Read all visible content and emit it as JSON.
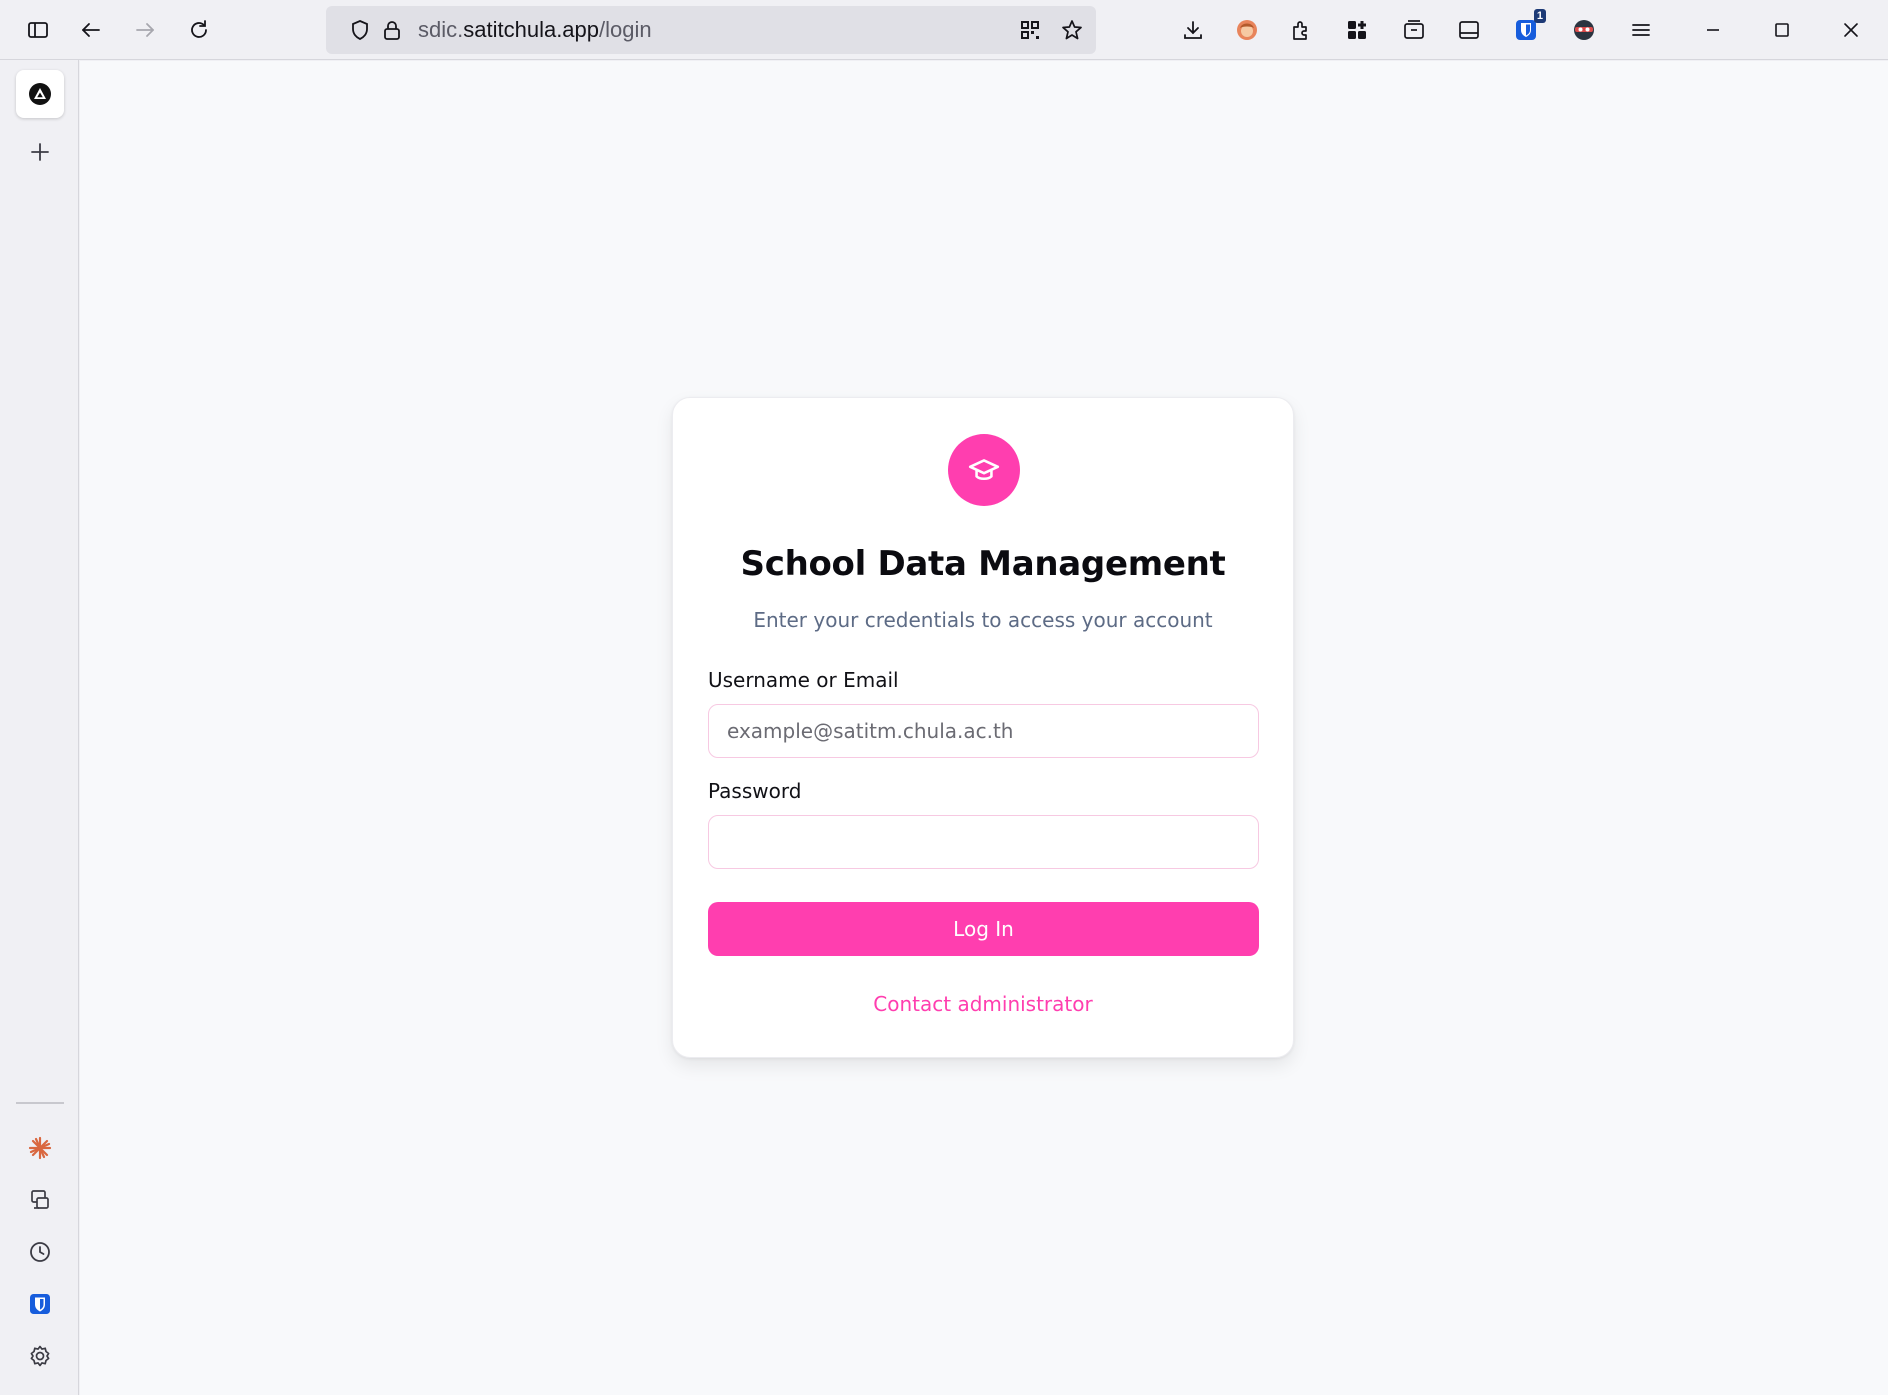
{
  "browser": {
    "url_prefix": "sdic.",
    "url_host": "satitchula.app",
    "url_path": "/login",
    "extension_badge": "1"
  },
  "sidebar": {
    "items": [
      {
        "icon": "app-logo-icon"
      },
      {
        "icon": "plus-icon"
      },
      {
        "icon": "claude-icon"
      },
      {
        "icon": "synced-tabs-icon"
      },
      {
        "icon": "history-icon"
      },
      {
        "icon": "bitwarden-icon"
      },
      {
        "icon": "gear-icon"
      }
    ]
  },
  "login": {
    "title": "School Data Management",
    "subtitle": "Enter your credentials to access your account",
    "username_label": "Username or Email",
    "username_placeholder": "example@satitm.chula.ac.th",
    "username_value": "",
    "password_label": "Password",
    "password_value": "",
    "submit_label": "Log In",
    "contact_label": "Contact administrator"
  },
  "colors": {
    "accent": "#ff3eaf",
    "page_background": "#f8f9fb",
    "subtitle": "#5d6b85"
  }
}
